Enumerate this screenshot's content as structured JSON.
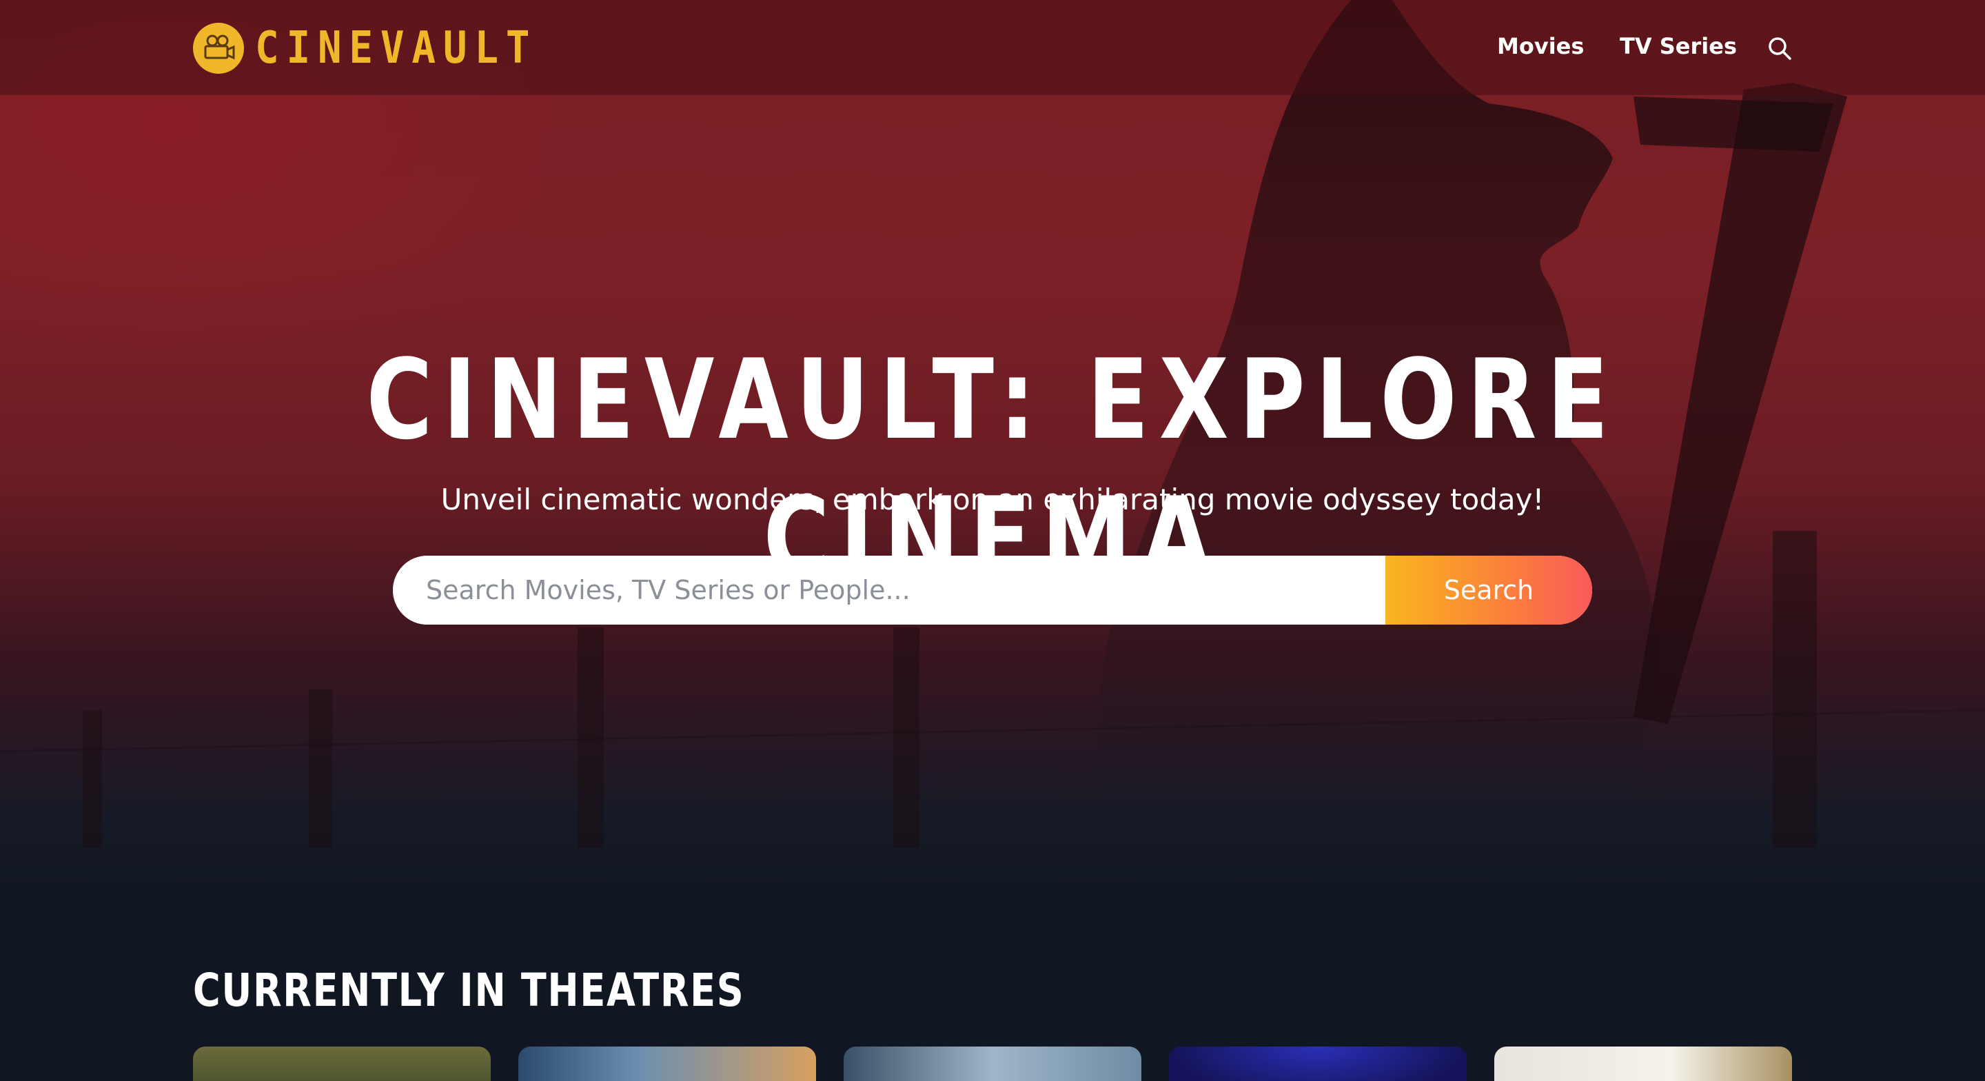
{
  "brand": {
    "name": "CINEVAULT",
    "logo_icon": "film-camera-icon",
    "color": "#f0b72a"
  },
  "nav": {
    "items": [
      {
        "label": "Movies"
      },
      {
        "label": "TV Series"
      }
    ],
    "search_icon": "search-icon"
  },
  "hero": {
    "title": "CINEVAULT: EXPLORE CINEMA",
    "subtitle": "Unveil cinematic wonders, embark on an exhilarating movie odyssey today!"
  },
  "search": {
    "placeholder": "Search Movies, TV Series or People...",
    "value": "",
    "button_label": "Search"
  },
  "section": {
    "title": "CURRENTLY IN THEATRES",
    "posters_count_visible": 5
  },
  "colors": {
    "accent_gradient_start": "#f9b61e",
    "accent_gradient_end": "#fa5a5a",
    "background": "#111722",
    "hero_red": "#7c2027"
  }
}
